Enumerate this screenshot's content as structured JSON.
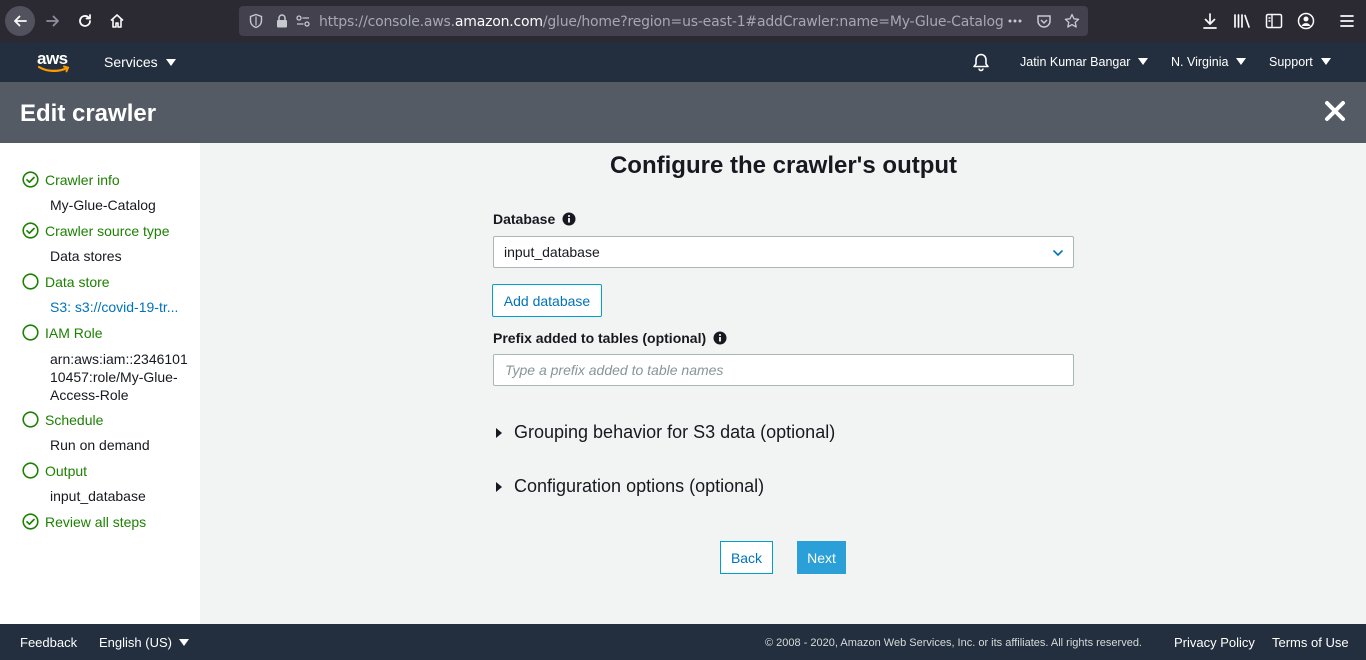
{
  "browser": {
    "url_prefix": "https://console.aws.",
    "url_host": "amazon.com",
    "url_suffix": "/glue/home?region=us-east-1#addCrawler:name=My-Glue-Catalog"
  },
  "header": {
    "logo": "aws",
    "services": "Services",
    "user": "Jatin Kumar Bangar",
    "region": "N. Virginia",
    "support": "Support"
  },
  "title": "Edit crawler",
  "sidebar": {
    "steps": [
      {
        "label": "Crawler info",
        "status": "complete",
        "value": "My-Glue-Catalog"
      },
      {
        "label": "Crawler source type",
        "status": "complete",
        "value": "Data stores"
      },
      {
        "label": "Data store",
        "status": "incomplete",
        "value": "S3: s3://covid-19-tr..."
      },
      {
        "label": "IAM Role",
        "status": "incomplete",
        "value_lines": [
          "arn:aws:iam::2346101",
          "10457:role/My-Glue-",
          "Access-Role"
        ]
      },
      {
        "label": "Schedule",
        "status": "incomplete",
        "value": "Run on demand"
      },
      {
        "label": "Output",
        "status": "incomplete",
        "value": "input_database"
      },
      {
        "label": "Review all steps",
        "status": "complete"
      }
    ]
  },
  "main": {
    "heading": "Configure the crawler's output",
    "database_label": "Database",
    "database_value": "input_database",
    "add_database": "Add database",
    "prefix_label": "Prefix added to tables (optional)",
    "prefix_placeholder": "Type a prefix added to table names",
    "grouping": "Grouping behavior for S3 data (optional)",
    "config": "Configuration options (optional)",
    "back": "Back",
    "next": "Next"
  },
  "footer": {
    "feedback": "Feedback",
    "language": "English (US)",
    "copyright": "© 2008 - 2020, Amazon Web Services, Inc. or its affiliates. All rights reserved.",
    "privacy": "Privacy Policy",
    "terms": "Terms of Use"
  },
  "colors": {
    "complete_green": "#1d8102",
    "link_blue": "#0073bb",
    "primary_button": "#2a9fd8",
    "header_dark": "#232f3e",
    "title_bar": "#545b64"
  }
}
